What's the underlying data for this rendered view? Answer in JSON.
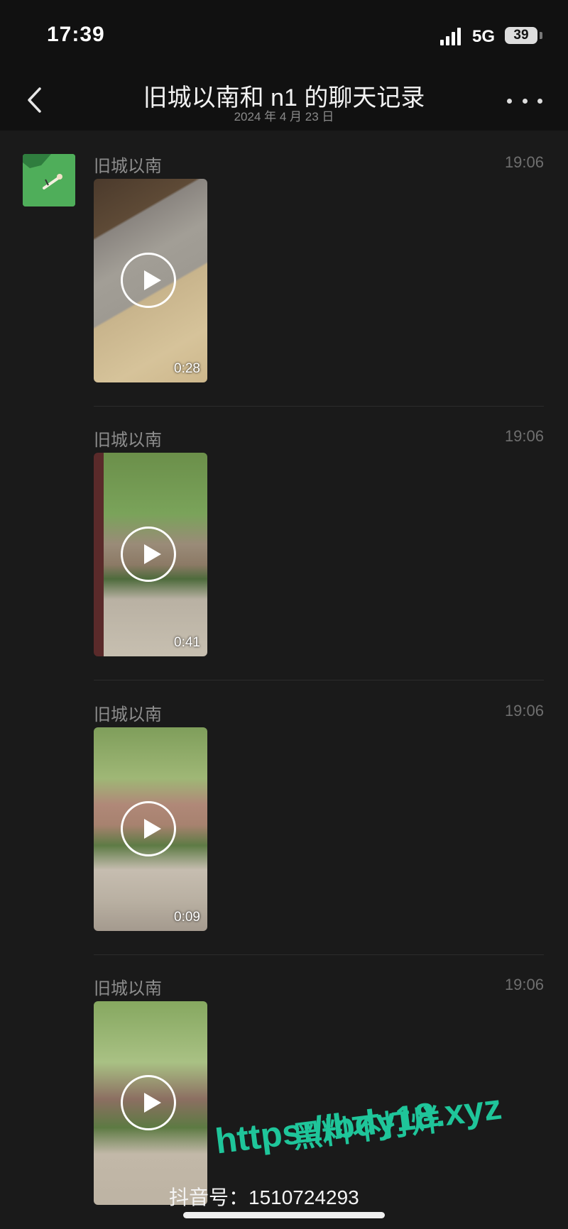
{
  "status_bar": {
    "time": "17:39",
    "network": "5G",
    "battery": "39"
  },
  "header": {
    "title": "旧城以南和 n1 的聊天记录",
    "date": "2024 年 4 月 23 日"
  },
  "messages": [
    {
      "sender": "旧城以南",
      "time": "19:06",
      "duration": "0:28"
    },
    {
      "sender": "旧城以南",
      "time": "19:06",
      "duration": "0:41"
    },
    {
      "sender": "旧城以南",
      "time": "19:06",
      "duration": "0:09"
    },
    {
      "sender": "旧城以南",
      "time": "19:06",
      "duration": ""
    }
  ],
  "watermark": {
    "line1": "黑料不打烊",
    "line2": "https://bdy18.xyz",
    "douyin_id": "抖音号：1510724293"
  }
}
